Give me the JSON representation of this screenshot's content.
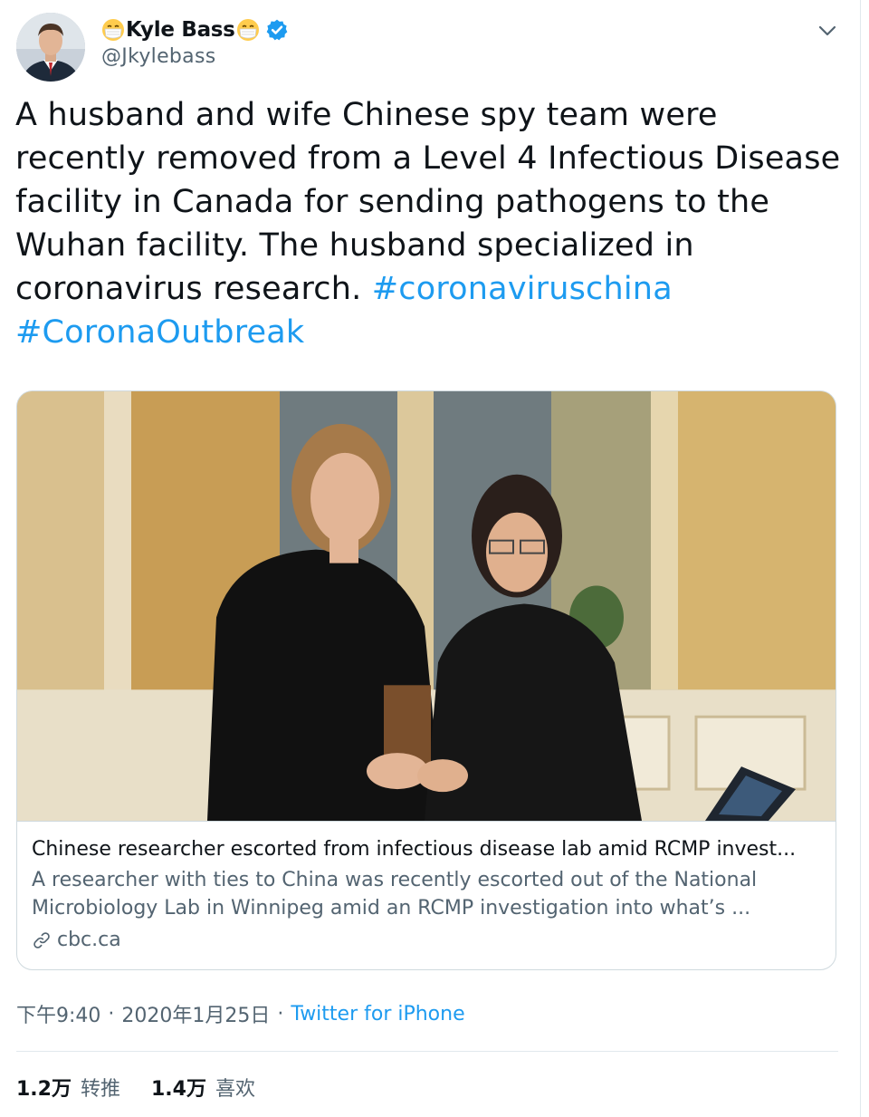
{
  "author": {
    "display_name": "Kyle Bass",
    "handle": "@Jkylebass",
    "name_emoji": "face-with-medical-mask",
    "verified": true
  },
  "tweet": {
    "text_lines": [
      "A husband and wife Chinese spy team were",
      "recently removed from a Level 4 Infectious Disease",
      "facility in Canada for sending pathogens to the",
      "Wuhan facility. The husband specialized in",
      "coronavirus research. "
    ],
    "hashtags": [
      "#coronaviruschina",
      "#CoronaOutbreak"
    ]
  },
  "card": {
    "title": "Chinese researcher escorted from infectious disease lab amid RCMP invest...",
    "description_lines": [
      "A researcher with ties to China was recently escorted out of the National",
      "Microbiology Lab in Winnipeg amid an RCMP investigation into what’s ..."
    ],
    "domain": "cbc.ca",
    "icon": "link-icon"
  },
  "meta": {
    "time": "下午9:40",
    "separator": "·",
    "date": "2020年1月25日",
    "source": "Twitter for iPhone"
  },
  "stats": {
    "retweets_count": "1.2万",
    "retweets_label": "转推",
    "likes_count": "1.4万",
    "likes_label": "喜欢"
  },
  "colors": {
    "link": "#1d9bf0",
    "secondary_text": "#536471",
    "primary_text": "#0f1419",
    "border": "#cfd9de"
  }
}
